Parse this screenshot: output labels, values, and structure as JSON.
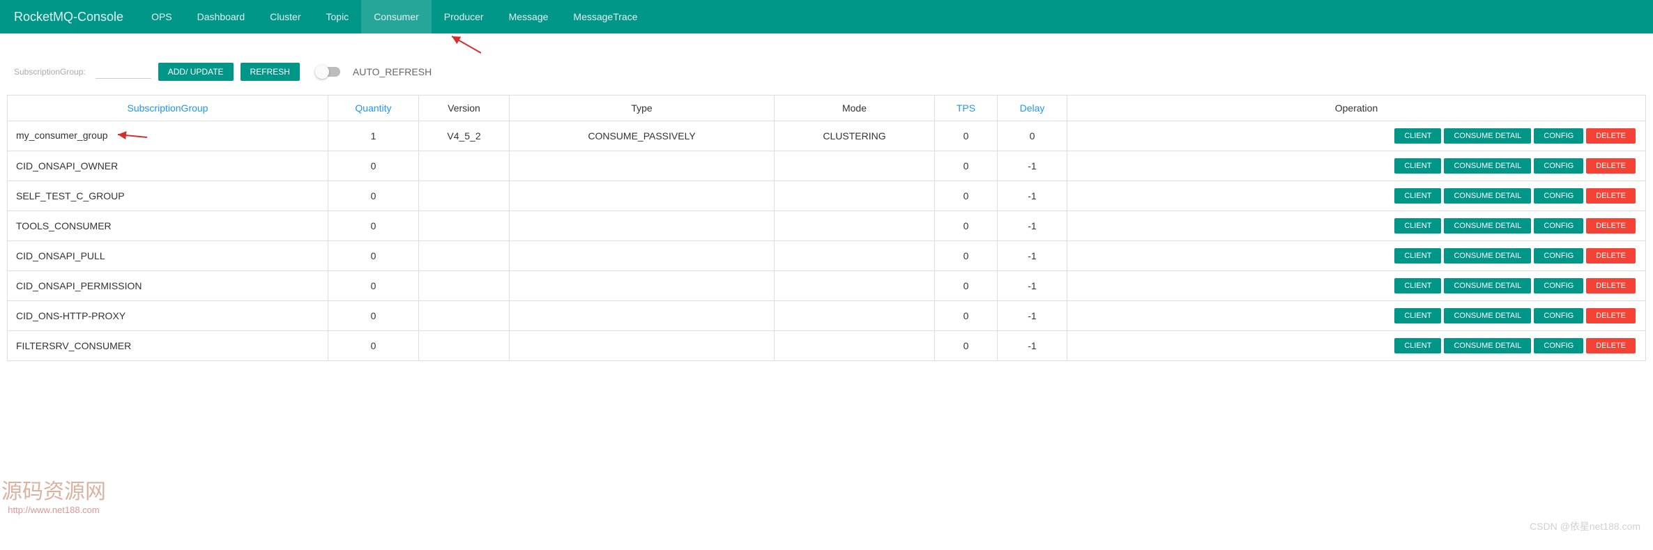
{
  "nav": {
    "brand": "RocketMQ-Console",
    "items": [
      "OPS",
      "Dashboard",
      "Cluster",
      "Topic",
      "Consumer",
      "Producer",
      "Message",
      "MessageTrace"
    ],
    "active": "Consumer"
  },
  "toolbar": {
    "filter_label": "SubscriptionGroup:",
    "filter_value": "",
    "add_update": "ADD/ UPDATE",
    "refresh": "REFRESH",
    "auto_refresh": "AUTO_REFRESH"
  },
  "table": {
    "headers": {
      "subscription_group": "SubscriptionGroup",
      "quantity": "Quantity",
      "version": "Version",
      "type": "Type",
      "mode": "Mode",
      "tps": "TPS",
      "delay": "Delay",
      "operation": "Operation"
    },
    "op_labels": {
      "client": "CLIENT",
      "consume_detail": "CONSUME DETAIL",
      "config": "CONFIG",
      "delete": "DELETE"
    },
    "rows": [
      {
        "group": "my_consumer_group",
        "quantity": "1",
        "version": "V4_5_2",
        "type": "CONSUME_PASSIVELY",
        "mode": "CLUSTERING",
        "tps": "0",
        "delay": "0",
        "highlight": true
      },
      {
        "group": "CID_ONSAPI_OWNER",
        "quantity": "0",
        "version": "",
        "type": "",
        "mode": "",
        "tps": "0",
        "delay": "-1"
      },
      {
        "group": "SELF_TEST_C_GROUP",
        "quantity": "0",
        "version": "",
        "type": "",
        "mode": "",
        "tps": "0",
        "delay": "-1"
      },
      {
        "group": "TOOLS_CONSUMER",
        "quantity": "0",
        "version": "",
        "type": "",
        "mode": "",
        "tps": "0",
        "delay": "-1"
      },
      {
        "group": "CID_ONSAPI_PULL",
        "quantity": "0",
        "version": "",
        "type": "",
        "mode": "",
        "tps": "0",
        "delay": "-1"
      },
      {
        "group": "CID_ONSAPI_PERMISSION",
        "quantity": "0",
        "version": "",
        "type": "",
        "mode": "",
        "tps": "0",
        "delay": "-1"
      },
      {
        "group": "CID_ONS-HTTP-PROXY",
        "quantity": "0",
        "version": "",
        "type": "",
        "mode": "",
        "tps": "0",
        "delay": "-1"
      },
      {
        "group": "FILTERSRV_CONSUMER",
        "quantity": "0",
        "version": "",
        "type": "",
        "mode": "",
        "tps": "0",
        "delay": "-1"
      }
    ]
  },
  "watermarks": {
    "w1_line1": "源码资源网",
    "w1_line2": "http://www.net188.com",
    "w2": "CSDN @依星net188.com"
  }
}
